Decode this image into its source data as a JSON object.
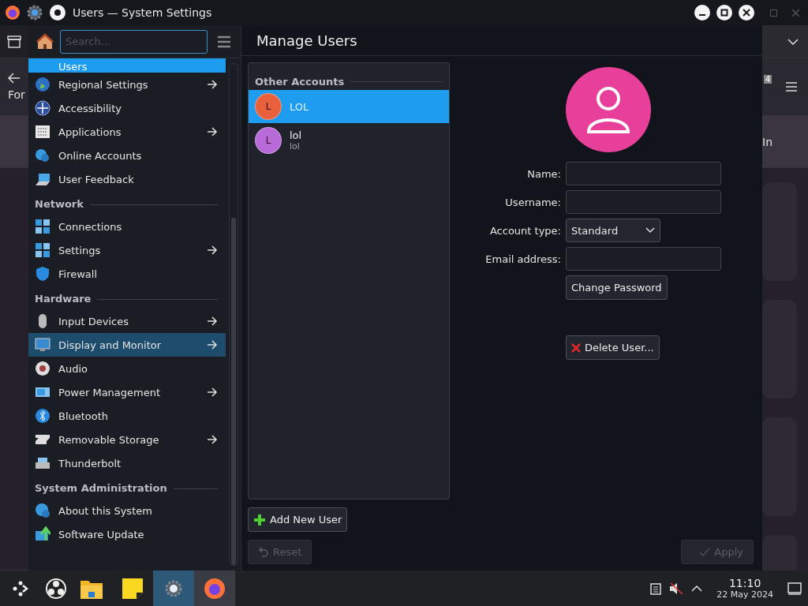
{
  "title_bar": {
    "title": "Users — System Settings"
  },
  "background_window": {
    "left_text": "For",
    "right_text": "In",
    "badge": "4"
  },
  "sidebar": {
    "search": {
      "placeholder": "Search..."
    },
    "groups": [
      {
        "items": [
          {
            "label": "Users",
            "selected": true,
            "hovered": false,
            "arrow": false
          },
          {
            "label": "Regional Settings",
            "selected": false,
            "hovered": false,
            "arrow": true
          },
          {
            "label": "Accessibility",
            "selected": false,
            "hovered": false,
            "arrow": false
          },
          {
            "label": "Applications",
            "selected": false,
            "hovered": false,
            "arrow": true
          },
          {
            "label": "Online Accounts",
            "selected": false,
            "hovered": false,
            "arrow": false
          },
          {
            "label": "User Feedback",
            "selected": false,
            "hovered": false,
            "arrow": false
          }
        ]
      },
      {
        "heading": "Network",
        "items": [
          {
            "label": "Connections",
            "selected": false,
            "hovered": false,
            "arrow": false
          },
          {
            "label": "Settings",
            "selected": false,
            "hovered": false,
            "arrow": true
          },
          {
            "label": "Firewall",
            "selected": false,
            "hovered": false,
            "arrow": false
          }
        ]
      },
      {
        "heading": "Hardware",
        "items": [
          {
            "label": "Input Devices",
            "selected": false,
            "hovered": false,
            "arrow": true
          },
          {
            "label": "Display and Monitor",
            "selected": false,
            "hovered": true,
            "arrow": true
          },
          {
            "label": "Audio",
            "selected": false,
            "hovered": false,
            "arrow": false
          },
          {
            "label": "Power Management",
            "selected": false,
            "hovered": false,
            "arrow": true
          },
          {
            "label": "Bluetooth",
            "selected": false,
            "hovered": false,
            "arrow": false
          },
          {
            "label": "Removable Storage",
            "selected": false,
            "hovered": false,
            "arrow": true
          },
          {
            "label": "Thunderbolt",
            "selected": false,
            "hovered": false,
            "arrow": false
          }
        ]
      },
      {
        "heading": "System Administration",
        "items": [
          {
            "label": "About this System",
            "selected": false,
            "hovered": false,
            "arrow": false
          },
          {
            "label": "Software Update",
            "selected": false,
            "hovered": false,
            "arrow": false
          }
        ]
      }
    ]
  },
  "content": {
    "title": "Manage Users",
    "accounts_heading": "Other Accounts",
    "accounts": [
      {
        "initial": "L",
        "name": "LOL",
        "selected": true,
        "color": "#e8613c"
      },
      {
        "initial": "L",
        "name": "lol",
        "username": "lol",
        "selected": false,
        "color": "#b86ad8"
      }
    ],
    "fields": [
      {
        "kind": "text",
        "label": "Name:"
      },
      {
        "kind": "text",
        "label": "Username:"
      },
      {
        "kind": "select",
        "label": "Account type:",
        "value": "Standard"
      },
      {
        "kind": "text",
        "label": "Email address:"
      }
    ],
    "change_password": "Change Password",
    "delete_user": "Delete User...",
    "add_user": "Add New User",
    "reset": {
      "label": "Reset",
      "disabled": true
    },
    "apply": {
      "label": "Apply",
      "disabled": true
    }
  },
  "taskbar": {
    "time": "11:10",
    "date": "22 May 2024"
  }
}
